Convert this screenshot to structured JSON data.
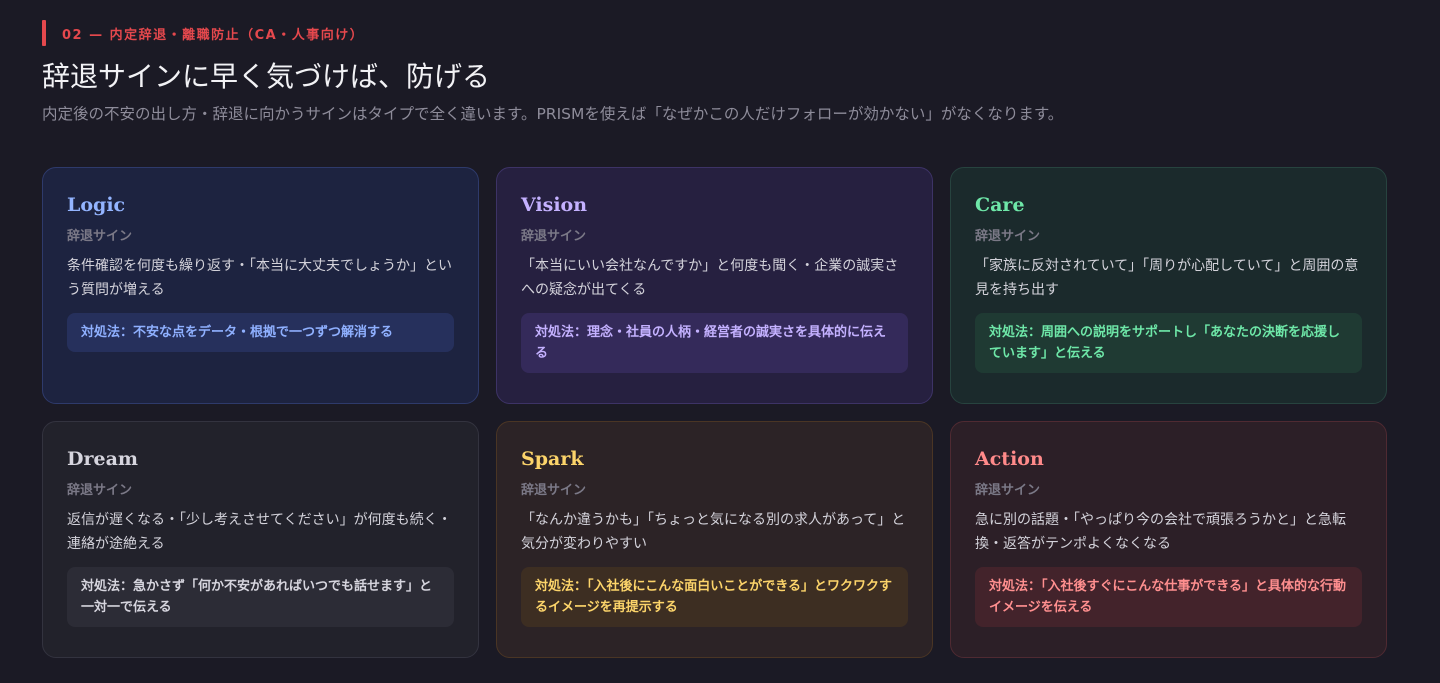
{
  "header": {
    "eyebrow": "02 — 内定辞退・離職防止（CA・人事向け）",
    "title": "辞退サインに早く気づけば、防げる",
    "subtitle": "内定後の不安の出し方・辞退に向かうサインはタイプで全く違います。PRISMを使えば「なぜかこの人だけフォローが効かない」がなくなります。"
  },
  "colors": {
    "background": "#1b1a25",
    "accent": "#e5484d",
    "logic": "#93b4ff",
    "vision": "#c4b1ff",
    "care": "#6ee7a8",
    "dream": "#d6d5de",
    "spark": "#fcd46a",
    "action": "#ff8a8a"
  },
  "cards": [
    {
      "name": "Logic",
      "sign_label": "辞退サイン",
      "description": "条件確認を何度も繰り返す・「本当に大丈夫でしょうか」という質問が増える",
      "fix_label": "対処法：",
      "fix_text": "不安な点をデータ・根拠で一つずつ解消する"
    },
    {
      "name": "Vision",
      "sign_label": "辞退サイン",
      "description": "「本当にいい会社なんですか」と何度も聞く・企業の誠実さへの疑念が出てくる",
      "fix_label": "対処法：",
      "fix_text": "理念・社員の人柄・経営者の誠実さを具体的に伝える"
    },
    {
      "name": "Care",
      "sign_label": "辞退サイン",
      "description": "「家族に反対されていて」「周りが心配していて」と周囲の意見を持ち出す",
      "fix_label": "対処法：",
      "fix_text": "周囲への説明をサポートし「あなたの決断を応援しています」と伝える"
    },
    {
      "name": "Dream",
      "sign_label": "辞退サイン",
      "description": "返信が遅くなる・「少し考えさせてください」が何度も続く・連絡が途絶える",
      "fix_label": "対処法：",
      "fix_text": "急かさず「何か不安があればいつでも話せます」と一対一で伝える"
    },
    {
      "name": "Spark",
      "sign_label": "辞退サイン",
      "description": "「なんか違うかも」「ちょっと気になる別の求人があって」と気分が変わりやすい",
      "fix_label": "対処法：",
      "fix_text": "「入社後にこんな面白いことができる」とワクワクするイメージを再提示する"
    },
    {
      "name": "Action",
      "sign_label": "辞退サイン",
      "description": "急に別の話題・「やっぱり今の会社で頑張ろうかと」と急転換・返答がテンポよくなくなる",
      "fix_label": "対処法：",
      "fix_text": "「入社後すぐにこんな仕事ができる」と具体的な行動イメージを伝える"
    }
  ]
}
